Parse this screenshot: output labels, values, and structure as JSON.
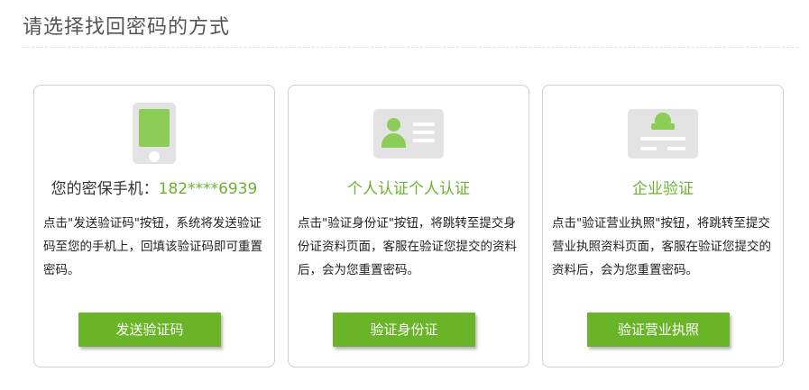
{
  "page": {
    "title": "请选择找回密码的方式"
  },
  "colors": {
    "accent": "#6ab527",
    "icon_green": "#8ccd58",
    "icon_bg": "#e3e3e3"
  },
  "cards": [
    {
      "icon": "phone-icon",
      "title_label": "您的密保手机：",
      "title_value": "182****6939",
      "description": "点击\"发送验证码\"按钮，系统将发送验证码至您的手机上，回填该验证码即可重置密码。",
      "button": "发送验证码"
    },
    {
      "icon": "id-card-icon",
      "title": "个人认证个人认证",
      "description": "点击\"验证身份证\"按钮，将跳转至提交身份证资料页面，客服在验证您提交的资料后，会为您重置密码。",
      "button": "验证身份证"
    },
    {
      "icon": "business-license-icon",
      "title": "企业验证",
      "description": "点击\"验证营业执照\"按钮，将跳转至提交营业执照资料页面，客服在验证您提交的资料后，会为您重置密码。",
      "button": "验证营业执照"
    }
  ]
}
